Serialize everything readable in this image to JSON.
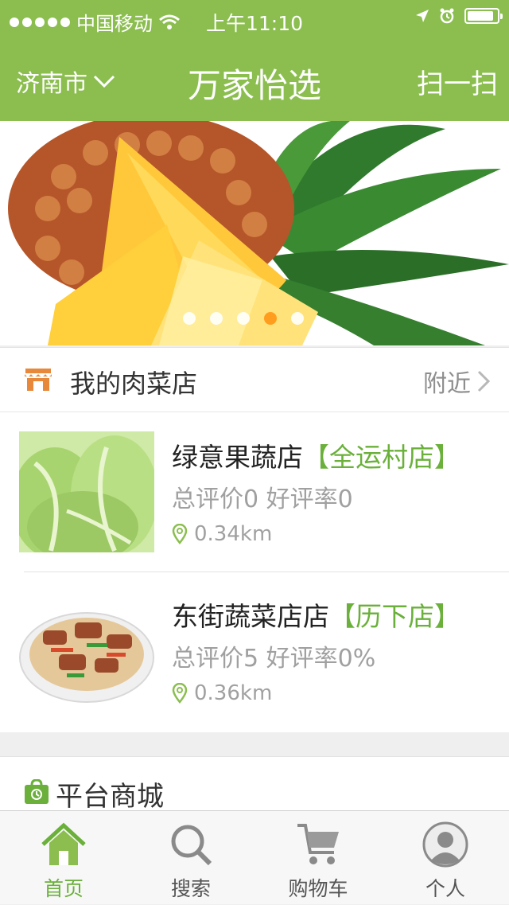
{
  "status_bar": {
    "carrier": "中国移动",
    "time": "上午11:10",
    "signal_dots": 5,
    "battery_level": 0.9
  },
  "header": {
    "city": "济南市",
    "title": "万家怡选",
    "scan": "扫一扫"
  },
  "banner": {
    "page_count": 5,
    "active_index": 3
  },
  "section": {
    "label": "我的肉菜店",
    "nearby": "附近"
  },
  "stores": [
    {
      "name": "绿意果蔬店",
      "branch": "【全运村店】",
      "rating": "总评价0 好评率0",
      "distance": "0.34km"
    },
    {
      "name": "东街蔬菜店店",
      "branch": "【历下店】",
      "rating": "总评价5 好评率0%",
      "distance": "0.36km"
    }
  ],
  "mall": {
    "label": "平台商城"
  },
  "tabs": [
    {
      "label": "首页",
      "icon": "home-icon",
      "active": true
    },
    {
      "label": "搜索",
      "icon": "search-icon",
      "active": false
    },
    {
      "label": "购物车",
      "icon": "cart-icon",
      "active": false
    },
    {
      "label": "个人",
      "icon": "user-icon",
      "active": false
    }
  ],
  "colors": {
    "brand_green": "#8bbe4f",
    "accent_green": "#6ab03a",
    "pagination_active": "#ff9d1e",
    "store_icon": "#e8883a"
  }
}
